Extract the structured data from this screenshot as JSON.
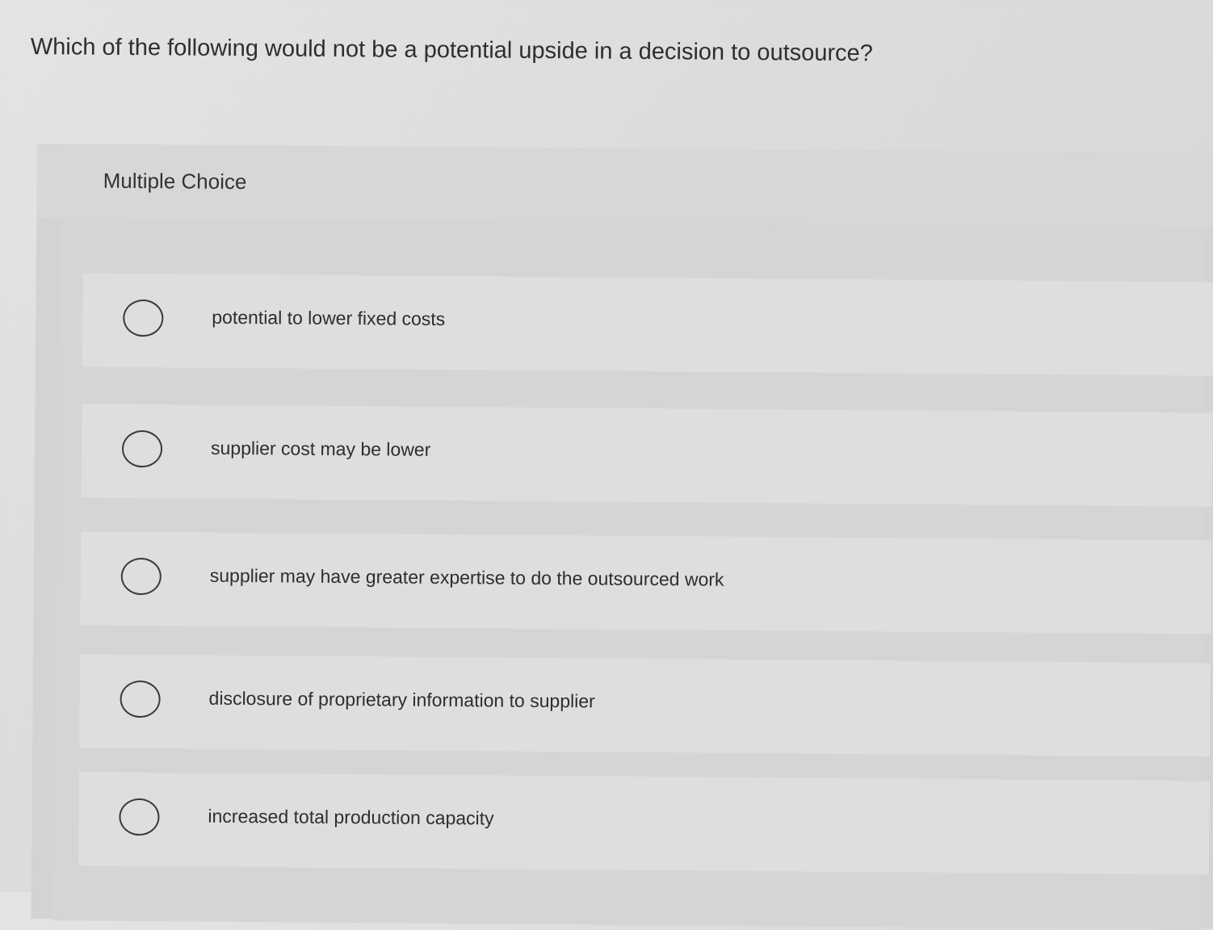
{
  "question": {
    "text": "Which of the following would not be a potential upside in a decision to outsource?"
  },
  "panel": {
    "title": "Multiple Choice"
  },
  "options": [
    {
      "label": "potential to lower fixed costs"
    },
    {
      "label": "supplier cost may be lower"
    },
    {
      "label": "supplier may have greater expertise to do the outsourced work"
    },
    {
      "label": "disclosure of proprietary information to supplier"
    },
    {
      "label": "increased total production capacity"
    }
  ],
  "colors": {
    "background": "#dcdcdc",
    "option_background": "#dedede",
    "text": "#2e2e2e",
    "radio_border": "#3a3a3a"
  }
}
